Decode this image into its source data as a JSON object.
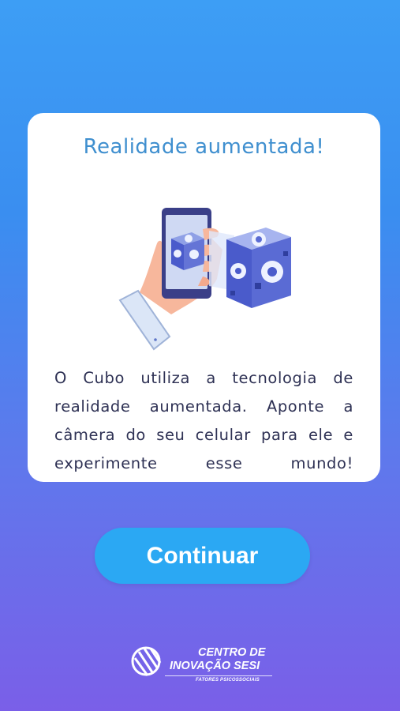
{
  "card": {
    "title": "Realidade aumentada!",
    "body": "O Cubo utiliza a tecnologia de realidade aumentada. Aponte a câmera do seu celular para ele e experimente esse mundo!",
    "illustration_icon": "hand-phone-cube-ar-icon"
  },
  "actions": {
    "continue_label": "Continuar"
  },
  "footer": {
    "logo_line1": "CENTRO DE",
    "logo_line2": "INOVAÇÃO SESI",
    "logo_sub": "FATORES PSICOSSOCIAIS"
  },
  "colors": {
    "background_top": "#3d9ef5",
    "background_bottom": "#7a5fe8",
    "title": "#3f8fcf",
    "body_text": "#2e3154",
    "button": "#2ba8f3"
  }
}
